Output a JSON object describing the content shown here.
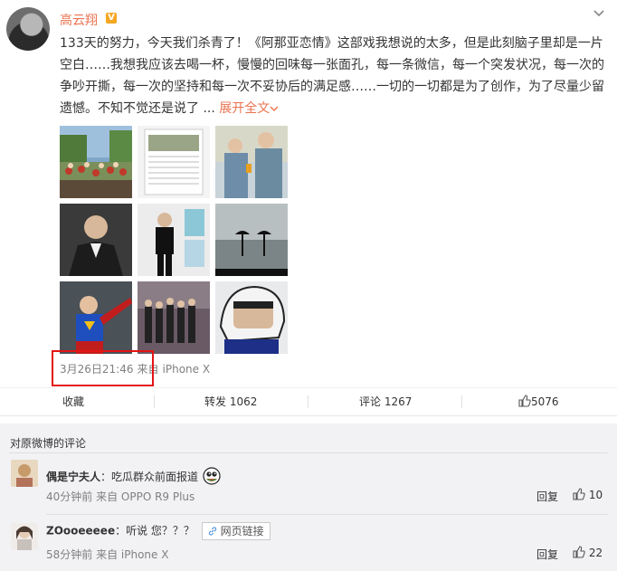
{
  "post": {
    "username": "高云翔",
    "verified_badge": "V",
    "menu_icon": "chevron-down-icon",
    "content": "133天的努力，今天我们杀青了！《阿那亚恋情》这部戏我想说的太多，但是此刻脑子里却是一片空白……我想我应该去喝一杯，慢慢的回味每一张面孔，每一条微信，每一个突发状况，每一次的争吵开撕，每一次的坚持和每一次不妥协后的满足感……一切的一切都是为了创作，为了尽量少留遗憾。不知不觉还是说了 ... ",
    "expand_label": "展开全文",
    "timestamp": "3月26日21:46",
    "source_prefix": "来自",
    "source": "iPhone X",
    "highlight_color": "#e41414",
    "accent_color": "#eb7350"
  },
  "actions": {
    "favorite": "收藏",
    "repost_label": "转发",
    "repost_count": "1062",
    "comment_label": "评论",
    "comment_count": "1267",
    "like_count": "5076"
  },
  "comments": {
    "section_title": "对原微博的评论",
    "items": [
      {
        "user": "偶是宁夫人",
        "separator": "：",
        "text": "吃瓜群众前面报道",
        "emoji": "melon-eating-emoji",
        "time": "40分钟前 来自 OPPO R9 Plus",
        "reply": "回复",
        "likes": "10"
      },
      {
        "user": "ZOooeeeee",
        "separator": "：",
        "text": "听说 您？？？",
        "link_label": "网页链接",
        "time": "58分钟前 来自 iPhone X",
        "reply": "回复",
        "likes": "22"
      }
    ]
  }
}
